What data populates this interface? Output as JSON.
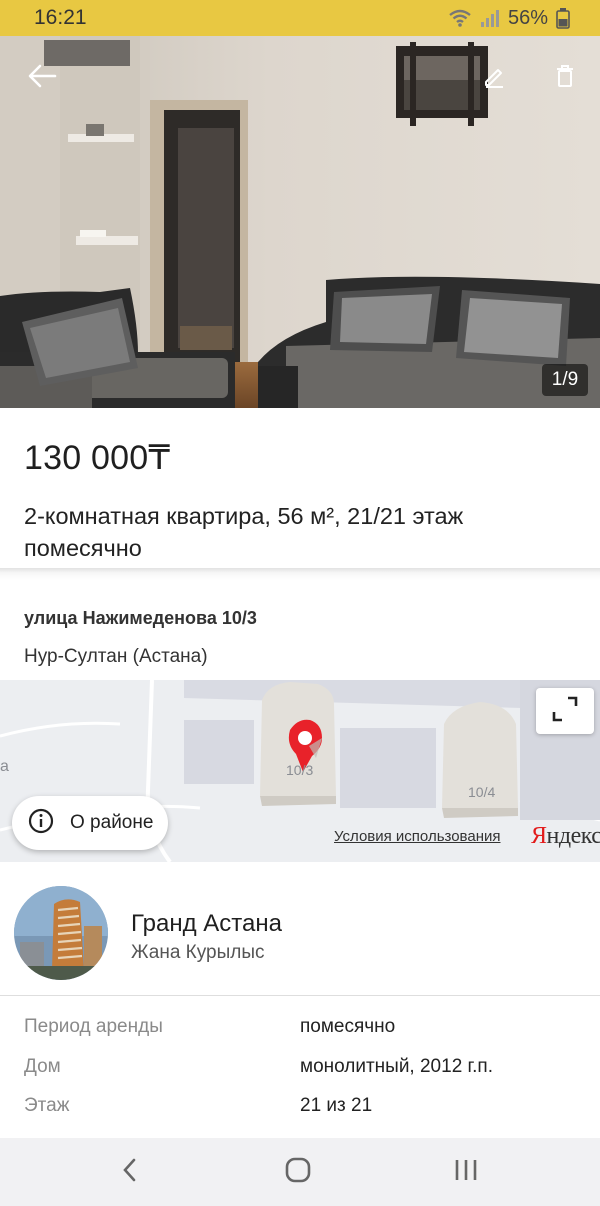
{
  "status_bar": {
    "time": "16:21",
    "battery": "56%",
    "icons": [
      "wifi-icon",
      "signal-icon",
      "battery-icon"
    ]
  },
  "gallery": {
    "counter": "1/9",
    "icons": [
      "back-arrow-icon",
      "edit-pencil-icon",
      "trash-icon"
    ]
  },
  "listing": {
    "price": "130 000",
    "currency": "₸",
    "title": "2-комнатная квартира, 56 м², 21/21 этаж помесячно"
  },
  "address": {
    "street": "улица Нажимеденова 10/3",
    "city": "Нур-Султан (Астана)"
  },
  "map": {
    "building_labels": [
      "10/3",
      "10/4"
    ],
    "edge_label": "а",
    "district_button": "О районе",
    "terms_link": "Условия использования",
    "brand": "Яндекс",
    "brand_first_letter": "Я",
    "brand_rest": "ндекс",
    "pin_color": "#e8222a"
  },
  "complex": {
    "name": "Гранд Астана",
    "developer": "Жана Курылыс"
  },
  "details": [
    {
      "key": "Период аренды",
      "value": "помесячно"
    },
    {
      "key": "Дом",
      "value": "монолитный, 2012 г.п."
    },
    {
      "key": "Этаж",
      "value": "21 из 21"
    }
  ],
  "nav_bar": {
    "icons": [
      "back-chevron-icon",
      "home-circle-icon",
      "recents-icon"
    ]
  },
  "colors": {
    "status_bar": "#e8c842",
    "map_pin": "#e8222a",
    "brand_red": "#e21b1b"
  }
}
